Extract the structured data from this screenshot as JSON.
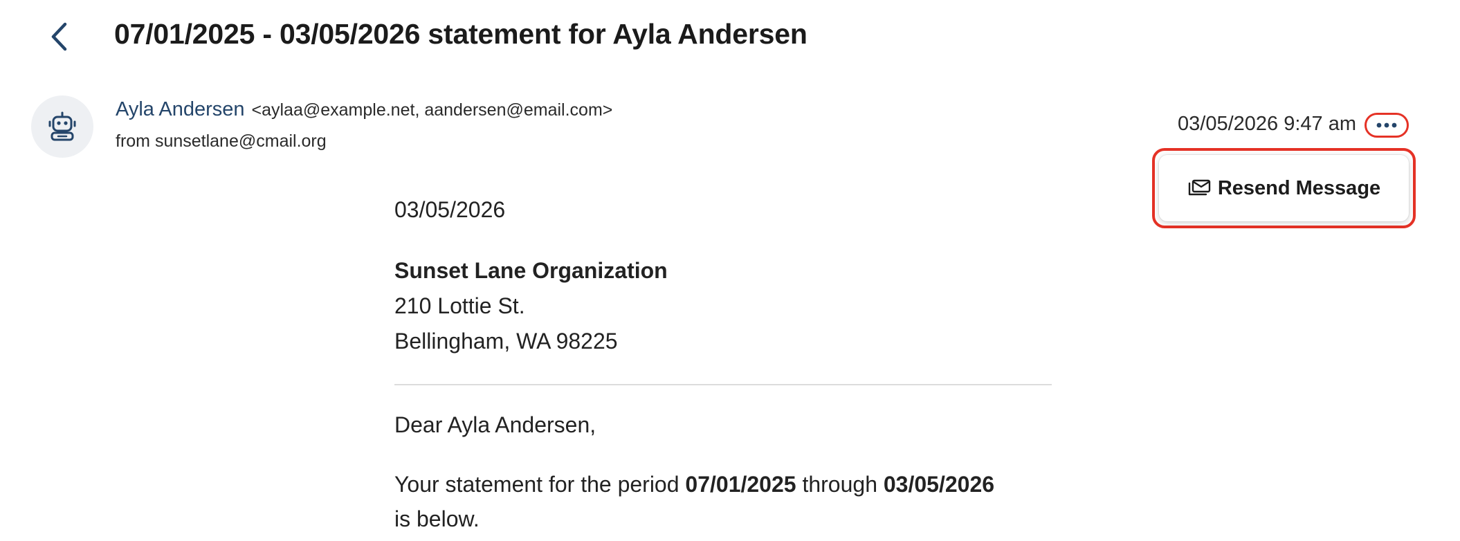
{
  "header": {
    "title": "07/01/2025 - 03/05/2026 statement for Ayla Andersen"
  },
  "icons": {
    "back": "chevron-left-icon",
    "avatar": "robot-icon",
    "more": "more-horizontal-icon",
    "resend": "envelope-stack-icon"
  },
  "message": {
    "sender_name": "Ayla Andersen",
    "recipients": "<aylaa@example.net, aandersen@email.com>",
    "from_line": "from sunsetlane@cmail.org",
    "timestamp": "03/05/2026 9:47 am"
  },
  "menu": {
    "resend_label": "Resend Message"
  },
  "letter": {
    "date": "03/05/2026",
    "org_name": "Sunset Lane Organization",
    "address_line1": "210 Lottie St.",
    "address_line2": "Bellingham, WA 98225",
    "greeting": "Dear Ayla Andersen,",
    "statement_prefix": "Your statement for the period",
    "period_start": "07/01/2025",
    "through_word": "through",
    "period_end": "03/05/2026",
    "statement_suffix": "is below."
  },
  "colors": {
    "accent_navy": "#24456a",
    "highlight_red": "#e53226",
    "avatar_bg": "#eef0f3"
  }
}
